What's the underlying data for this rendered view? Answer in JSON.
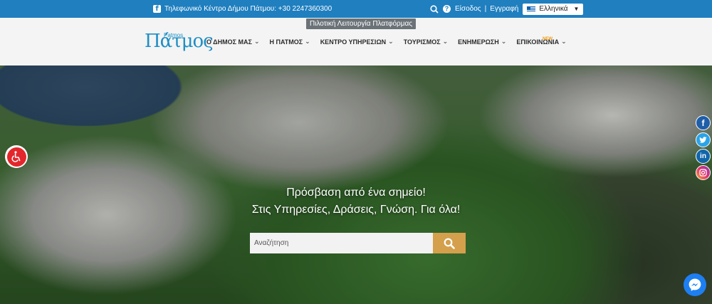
{
  "topbar": {
    "phone_text": "Τηλεφωνικό Κέντρο Δήμου Πάτμου: +30 2247360300",
    "login": "Είσοδος",
    "separator": "|",
    "register": "Εγγραφή",
    "language": "Ελληνικά"
  },
  "tooltip": "Πιλοτική Λειτουργία Πλατφόρμας",
  "logo": {
    "big": "Πάτμος",
    "small": "Patmos"
  },
  "menu": [
    {
      "label": "Ο ΔΗΜΟΣ ΜΑΣ"
    },
    {
      "label": "Η ΠΑΤΜΟΣ"
    },
    {
      "label": "ΚΕΝΤΡΟ ΥΠΗΡΕΣΙΩΝ"
    },
    {
      "label": "ΤΟΥΡΙΣΜΟΣ"
    },
    {
      "label": "ΕΝΗΜΕΡΩΣΗ"
    },
    {
      "label": "ΕΠΙΚΟΙΝΩΝΙΑ"
    }
  ],
  "new_badge": "NEW",
  "hero": {
    "line1": "Πρόσβαση από ένα σημείο!",
    "line2": "Στις Υπηρεσίες, Δράσεις, Γνώση. Για όλα!"
  },
  "search": {
    "placeholder": "Αναζήτηση"
  },
  "colors": {
    "topbar": "#1f7fbf",
    "accent_search": "#d4a04c",
    "accessibility": "#e3262b",
    "messenger": "#1e7ff2"
  }
}
